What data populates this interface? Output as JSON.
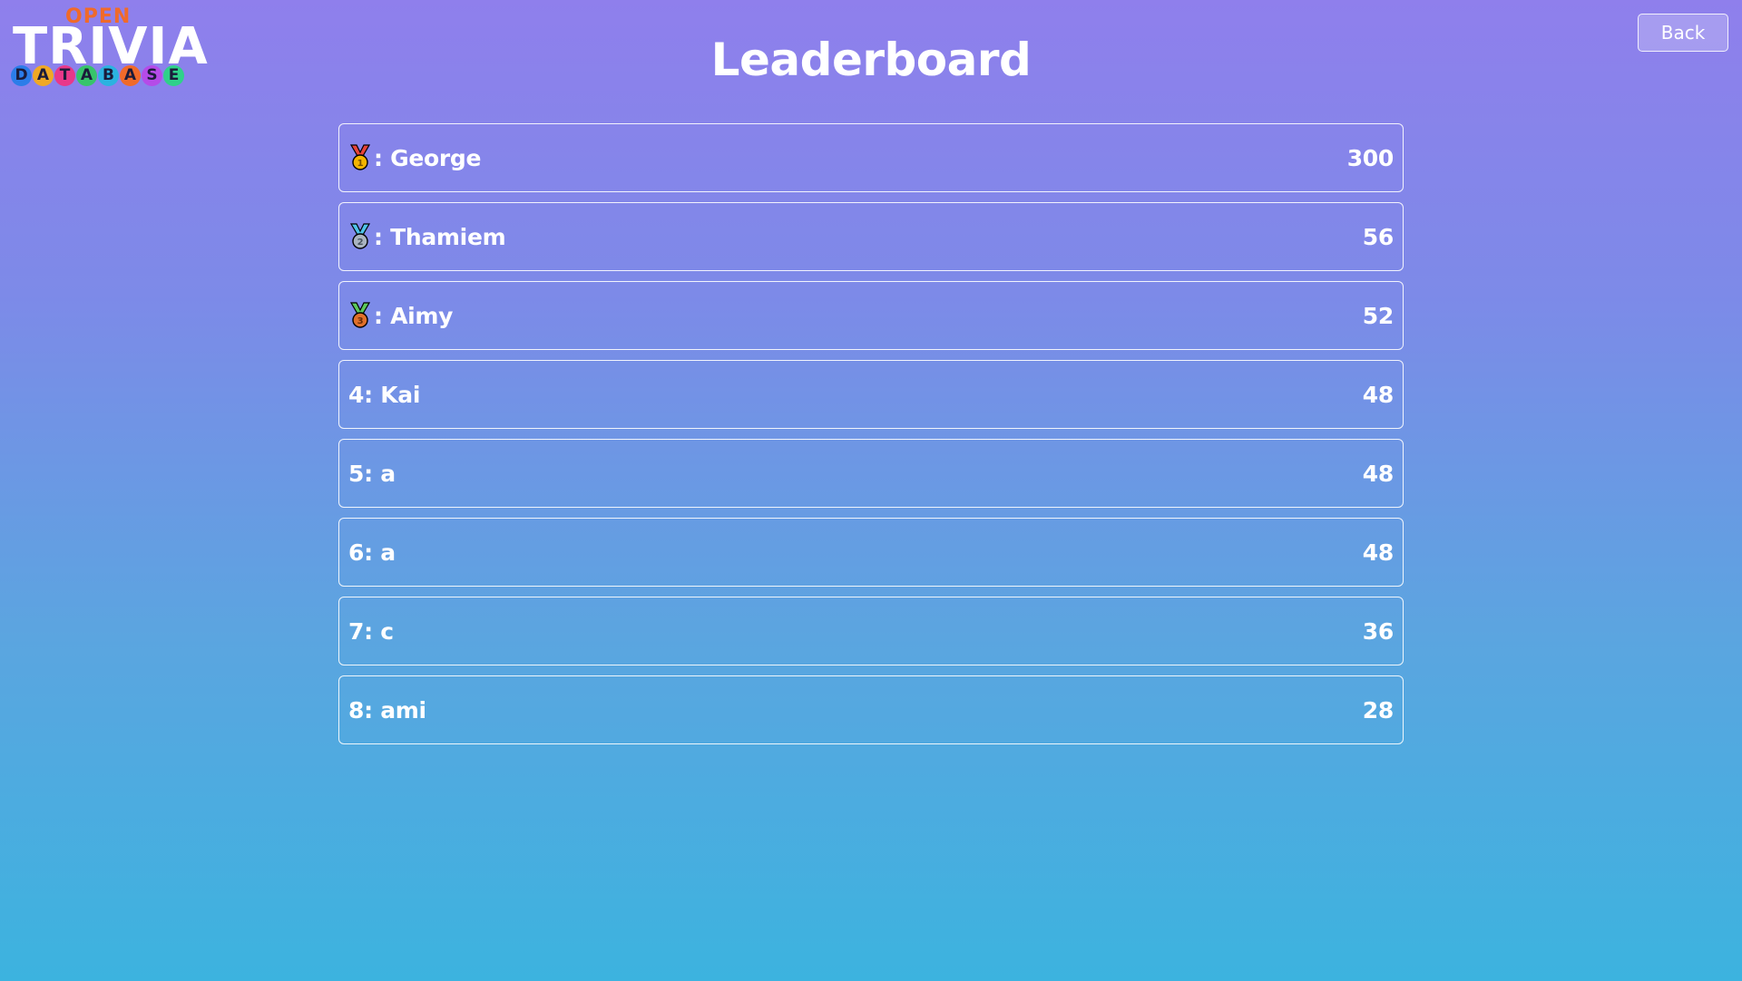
{
  "logo": {
    "top_text": "OPEN",
    "main_text": "TRIVIA",
    "bottom_letters": [
      "D",
      "A",
      "T",
      "A",
      "B",
      "A",
      "S",
      "E"
    ],
    "bottom_colors": [
      "#2b7de9",
      "#f0a825",
      "#e8388a",
      "#37c46a",
      "#2bb3e0",
      "#f06a2a",
      "#b54be8",
      "#2fd18a"
    ]
  },
  "header": {
    "title": "Leaderboard",
    "back_label": "Back"
  },
  "leaderboard": [
    {
      "rank_label": ": George",
      "medal": "gold-medal-icon",
      "score": "300"
    },
    {
      "rank_label": ": Thamiem",
      "medal": "silver-medal-icon",
      "score": "56"
    },
    {
      "rank_label": ": Aimy",
      "medal": "bronze-medal-icon",
      "score": "52"
    },
    {
      "rank_label": "4: Kai",
      "medal": null,
      "score": "48"
    },
    {
      "rank_label": "5: a",
      "medal": null,
      "score": "48"
    },
    {
      "rank_label": "6: a",
      "medal": null,
      "score": "48"
    },
    {
      "rank_label": "7: c",
      "medal": null,
      "score": "36"
    },
    {
      "rank_label": "8: ami",
      "medal": null,
      "score": "28"
    }
  ],
  "colors": {
    "gradient_top": "#8f7fec",
    "gradient_bottom": "#3cb3df",
    "medal_gold": "#f4b400",
    "medal_silver": "#aab4c0",
    "medal_bronze": "#e0702a"
  }
}
